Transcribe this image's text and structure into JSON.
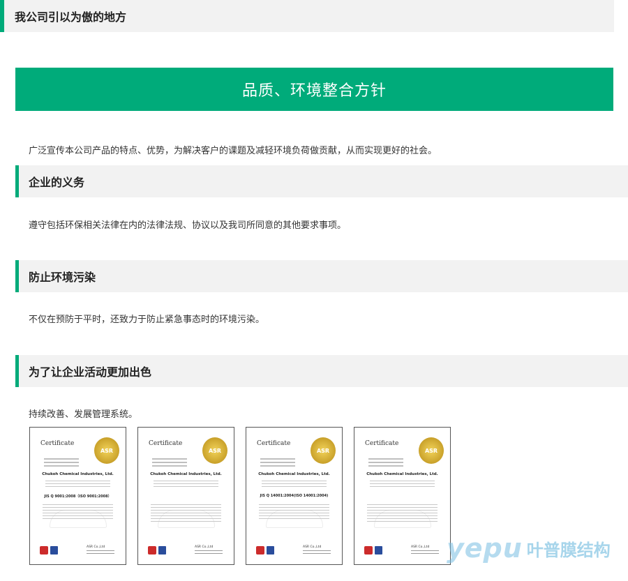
{
  "header": {
    "title": "我公司引以为傲的地方"
  },
  "banner": {
    "title": "品质、环境整合方针"
  },
  "intro": {
    "text": "广泛宣传本公司产品的特点、优势，为解决客户的课题及减轻环境负荷做贡献，从而实现更好的社会。"
  },
  "sections": [
    {
      "title": "企业的义务",
      "text": "遵守包括环保相关法律在内的法律法规、协议以及我司所同意的其他要求事项。"
    },
    {
      "title": "防止环境污染",
      "text": "不仅在预防于平时，还致力于防止紧急事态时的环境污染。"
    },
    {
      "title": "为了让企业活动更加出色",
      "text": "持续改善、发展管理系统。"
    }
  ],
  "certificates": [
    {
      "title": "Certificate",
      "seal": "ASR",
      "company": "Chukoh Chemical Industries, Ltd.",
      "standard": "JIS Q 9001:2008（ISO 9001:2008）",
      "issuer": "ASR Co.,Ltd"
    },
    {
      "title": "Certificate",
      "seal": "ASR",
      "company": "Chukoh Chemical Industries, Ltd.",
      "standard": "",
      "issuer": "ASR Co.,Ltd"
    },
    {
      "title": "Certificate",
      "seal": "ASR",
      "company": "Chukoh Chemical Industries, Ltd.",
      "standard": "JIS Q 14001:2004(ISO 14001:2004)",
      "issuer": "ASR Co.,Ltd"
    },
    {
      "title": "Certificate",
      "seal": "ASR",
      "company": "Chukoh Chemical Industries, Ltd.",
      "standard": "",
      "issuer": "ASR Co.,Ltd"
    }
  ],
  "watermark": {
    "latin": "yepu",
    "chinese": "叶普膜结构"
  },
  "colors": {
    "accent": "#00ab7a",
    "section_bg": "#f2f2f2",
    "text": "#333333"
  }
}
